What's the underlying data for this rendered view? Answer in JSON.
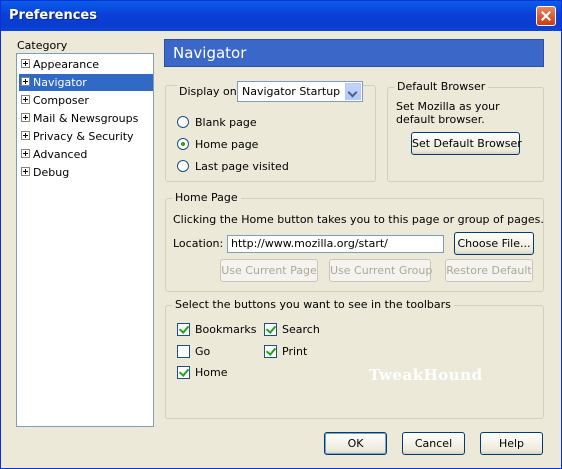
{
  "window": {
    "title": "Preferences"
  },
  "category": {
    "label": "Category",
    "items": [
      {
        "label": "Appearance"
      },
      {
        "label": "Navigator"
      },
      {
        "label": "Composer"
      },
      {
        "label": "Mail & Newsgroups"
      },
      {
        "label": "Privacy & Security"
      },
      {
        "label": "Advanced"
      },
      {
        "label": "Debug"
      }
    ]
  },
  "panel": {
    "title": "Navigator"
  },
  "display": {
    "label": "Display on",
    "select_value": "Navigator Startup",
    "options": [
      {
        "label": "Blank page",
        "checked": false
      },
      {
        "label": "Home page",
        "checked": true
      },
      {
        "label": "Last page visited",
        "checked": false
      }
    ]
  },
  "default_browser": {
    "title": "Default Browser",
    "description": "Set Mozilla as your default browser.",
    "button": "Set Default Browser"
  },
  "home_page": {
    "title": "Home Page",
    "description": "Clicking the Home button takes you to this page or group of pages.",
    "location_label": "Location:",
    "location_value": "http://www.mozilla.org/start/",
    "choose_file": "Choose File...",
    "use_current_page": "Use Current Page",
    "use_current_group": "Use Current Group",
    "restore_default": "Restore Default"
  },
  "toolbars": {
    "title": "Select the buttons you want to see in the toolbars",
    "bookmarks": {
      "label": "Bookmarks",
      "checked": true
    },
    "search": {
      "label": "Search",
      "checked": true
    },
    "go": {
      "label": "Go",
      "checked": false
    },
    "print": {
      "label": "Print",
      "checked": true
    },
    "home": {
      "label": "Home",
      "checked": true
    }
  },
  "watermark": "TweakHound",
  "footer": {
    "ok": "OK",
    "cancel": "Cancel",
    "help": "Help"
  },
  "colors": {
    "titlebar": "#0b3fd8",
    "selection": "#316ac5",
    "header": "#3b67c8"
  }
}
